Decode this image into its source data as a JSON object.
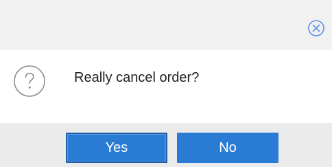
{
  "dialog": {
    "message": "Really cancel order?",
    "close_icon": "close-circle-icon",
    "question_icon": "question-circle-icon",
    "buttons": {
      "yes_label": "Yes",
      "no_label": "No"
    },
    "colors": {
      "title_bar_bg": "#f1f1f1",
      "footer_bg": "#ebebeb",
      "button_bg": "#2a7bd4",
      "icon_blue": "#5b8ee6",
      "icon_gray": "#8a8a8a"
    }
  }
}
